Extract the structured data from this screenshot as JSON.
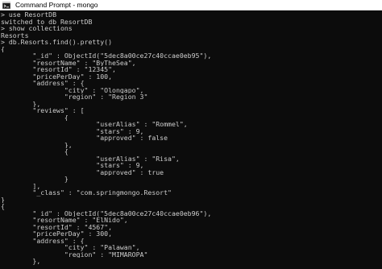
{
  "window": {
    "title": "Command Prompt - mongo",
    "icon": "command-prompt-icon"
  },
  "colors": {
    "background": "#0c0c0c",
    "text": "#cccccc",
    "titlebar": "#ffffff"
  },
  "console": {
    "lines": [
      "> use ResortDB",
      "switched to db ResortDB",
      "> show collections",
      "Resorts",
      "> db.Resorts.find().pretty()",
      "{",
      "        \"_id\" : ObjectId(\"5dec8a00ce27c40ccae0eb95\"),",
      "        \"resortName\" : \"ByTheSea\",",
      "        \"resortId\" : \"12345\",",
      "        \"pricePerDay\" : 100,",
      "        \"address\" : {",
      "                \"city\" : \"Olongapo\",",
      "                \"region\" : \"Region 3\"",
      "        },",
      "        \"reviews\" : [",
      "                {",
      "                        \"userAlias\" : \"Rommel\",",
      "                        \"stars\" : 9,",
      "                        \"approved\" : false",
      "                },",
      "                {",
      "                        \"userAlias\" : \"Risa\",",
      "                        \"stars\" : 9,",
      "                        \"approved\" : true",
      "                }",
      "        ],",
      "        \"_class\" : \"com.springmongo.Resort\"",
      "}",
      "{",
      "        \"_id\" : ObjectId(\"5dec8a00ce27c40ccae0eb96\"),",
      "        \"resortName\" : \"ElNido\",",
      "        \"resortId\" : \"4567\",",
      "        \"pricePerDay\" : 300,",
      "        \"address\" : {",
      "                \"city\" : \"Palawan\",",
      "                \"region\" : \"MIMAROPA\"",
      "        },"
    ]
  }
}
